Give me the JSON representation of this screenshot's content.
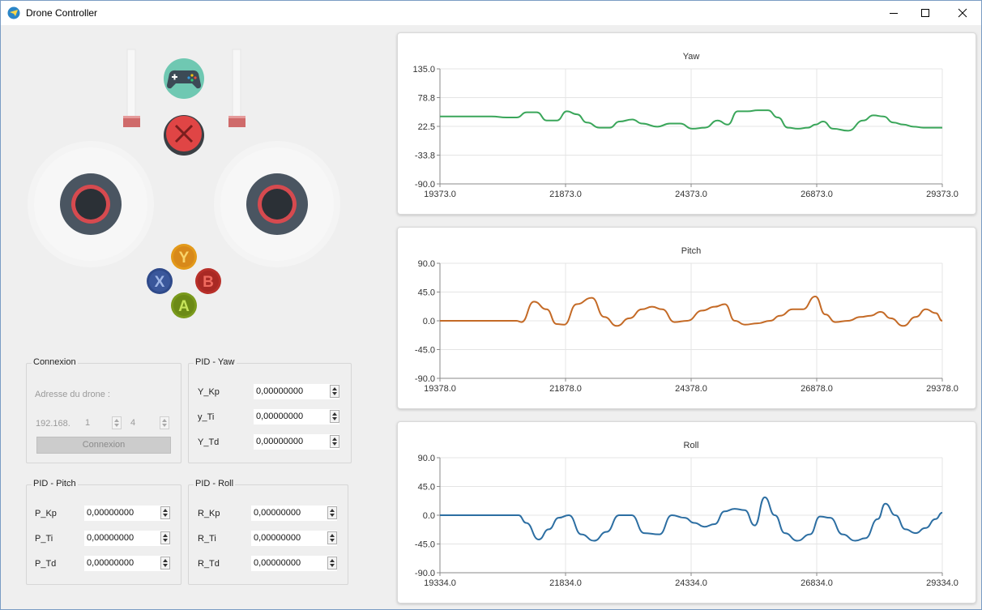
{
  "window": {
    "title": "Drone Controller",
    "controls": [
      "minimize",
      "maximize",
      "close"
    ]
  },
  "gamepad": {
    "icons": [
      "gamepad-icon",
      "stop-icon"
    ],
    "face_buttons": {
      "y": {
        "label": "Y",
        "color": "#e39a1a"
      },
      "x": {
        "label": "X",
        "color": "#2f4a8a"
      },
      "b": {
        "label": "B",
        "color": "#b8302a"
      },
      "a": {
        "label": "A",
        "color": "#7a9a1c"
      }
    },
    "colors": {
      "gamepad_icon_bg": "#6fc8b2",
      "stop_button": "#e04545",
      "joystick": "#4a5561",
      "joystick_ring": "#d64a4f",
      "trigger": "#cf6a6a"
    }
  },
  "connexion": {
    "title": "Connexion",
    "address_label": "Adresse du drone :",
    "ip_prefix": "192.168.",
    "ip_octet3": "1",
    "ip_octet4": "4",
    "button_label": "Connexion"
  },
  "pid_yaw": {
    "title": "PID - Yaw",
    "rows": [
      {
        "label": "Y_Kp",
        "value": "0,00000000"
      },
      {
        "label": "y_Ti",
        "value": "0,00000000"
      },
      {
        "label": "Y_Td",
        "value": "0,00000000"
      }
    ]
  },
  "pid_pitch": {
    "title": "PID - Pitch",
    "rows": [
      {
        "label": "P_Kp",
        "value": "0,00000000"
      },
      {
        "label": "P_Ti",
        "value": "0,00000000"
      },
      {
        "label": "P_Td",
        "value": "0,00000000"
      }
    ]
  },
  "pid_roll": {
    "title": "PID - Roll",
    "rows": [
      {
        "label": "R_Kp",
        "value": "0,00000000"
      },
      {
        "label": "R_Ti",
        "value": "0,00000000"
      },
      {
        "label": "R_Td",
        "value": "0,00000000"
      }
    ]
  },
  "chart_data": [
    {
      "type": "line",
      "title": "Yaw",
      "color": "#3aa65a",
      "xlim": [
        19373.0,
        29373.0
      ],
      "ylim": [
        -90.0,
        135.0
      ],
      "xticks": [
        "19373.0",
        "21873.0",
        "24373.0",
        "26873.0",
        "29373.0"
      ],
      "yticks": [
        "135.0",
        "78.8",
        "22.5",
        "-33.8",
        "-90.0"
      ],
      "x": [
        19373,
        20400,
        20700,
        20900,
        21100,
        21300,
        21500,
        21700,
        21900,
        22100,
        22300,
        22550,
        22750,
        22950,
        23200,
        23400,
        23700,
        23950,
        24150,
        24400,
        24650,
        24900,
        25100,
        25300,
        25500,
        25700,
        25900,
        26100,
        26300,
        26500,
        26700,
        26850,
        27000,
        27200,
        27500,
        27800,
        28000,
        28200,
        28400,
        28600,
        28800,
        29000,
        29200,
        29373
      ],
      "values": [
        42,
        42,
        40,
        40,
        50,
        50,
        34,
        34,
        52,
        46,
        30,
        20,
        20,
        32,
        36,
        28,
        22,
        28,
        28,
        18,
        20,
        34,
        26,
        52,
        52,
        54,
        54,
        40,
        20,
        18,
        20,
        26,
        32,
        18,
        14,
        34,
        44,
        42,
        30,
        26,
        22,
        20,
        20,
        20
      ]
    },
    {
      "type": "line",
      "title": "Pitch",
      "color": "#c46a26",
      "xlim": [
        19378.0,
        29378.0
      ],
      "ylim": [
        -90.0,
        90.0
      ],
      "xticks": [
        "19378.0",
        "21878.0",
        "24378.0",
        "26878.0",
        "29378.0"
      ],
      "yticks": [
        "90.0",
        "45.0",
        "0.0",
        "-45.0",
        "-90.0"
      ],
      "x": [
        19378,
        20900,
        21000,
        21250,
        21500,
        21700,
        21850,
        22100,
        22400,
        22650,
        22900,
        23150,
        23400,
        23600,
        23800,
        24050,
        24300,
        24600,
        24850,
        25050,
        25250,
        25450,
        25700,
        25950,
        26150,
        26400,
        26600,
        26850,
        27050,
        27250,
        27500,
        27750,
        27950,
        28150,
        28350,
        28600,
        28850,
        29050,
        29250,
        29378
      ],
      "values": [
        0,
        0,
        -2,
        30,
        18,
        -5,
        -6,
        26,
        36,
        6,
        -8,
        4,
        18,
        22,
        18,
        -2,
        0,
        16,
        22,
        26,
        0,
        -6,
        -4,
        0,
        8,
        18,
        18,
        38,
        10,
        -2,
        0,
        6,
        8,
        14,
        4,
        -8,
        6,
        18,
        12,
        0
      ]
    },
    {
      "type": "line",
      "title": "Roll",
      "color": "#2c6ea2",
      "xlim": [
        19334.0,
        29334.0
      ],
      "ylim": [
        -90.0,
        90.0
      ],
      "xticks": [
        "19334.0",
        "21834.0",
        "24334.0",
        "26834.0",
        "29334.0"
      ],
      "yticks": [
        "90.0",
        "45.0",
        "0.0",
        "-45.0",
        "-90.0"
      ],
      "x": [
        19334,
        20900,
        21050,
        21300,
        21500,
        21700,
        21900,
        22150,
        22400,
        22650,
        22900,
        23150,
        23400,
        23700,
        23950,
        24200,
        24400,
        24600,
        24800,
        25000,
        25200,
        25400,
        25600,
        25800,
        26000,
        26200,
        26450,
        26700,
        26900,
        27100,
        27350,
        27600,
        27800,
        28050,
        28200,
        28400,
        28600,
        28800,
        29000,
        29200,
        29334
      ],
      "values": [
        0,
        0,
        -12,
        -38,
        -22,
        -4,
        0,
        -30,
        -40,
        -26,
        0,
        0,
        -28,
        -30,
        0,
        -4,
        -12,
        -18,
        -14,
        6,
        10,
        8,
        -16,
        28,
        0,
        -28,
        -40,
        -30,
        -2,
        -4,
        -30,
        -40,
        -36,
        -6,
        18,
        0,
        -22,
        -28,
        -20,
        -6,
        4
      ]
    }
  ]
}
